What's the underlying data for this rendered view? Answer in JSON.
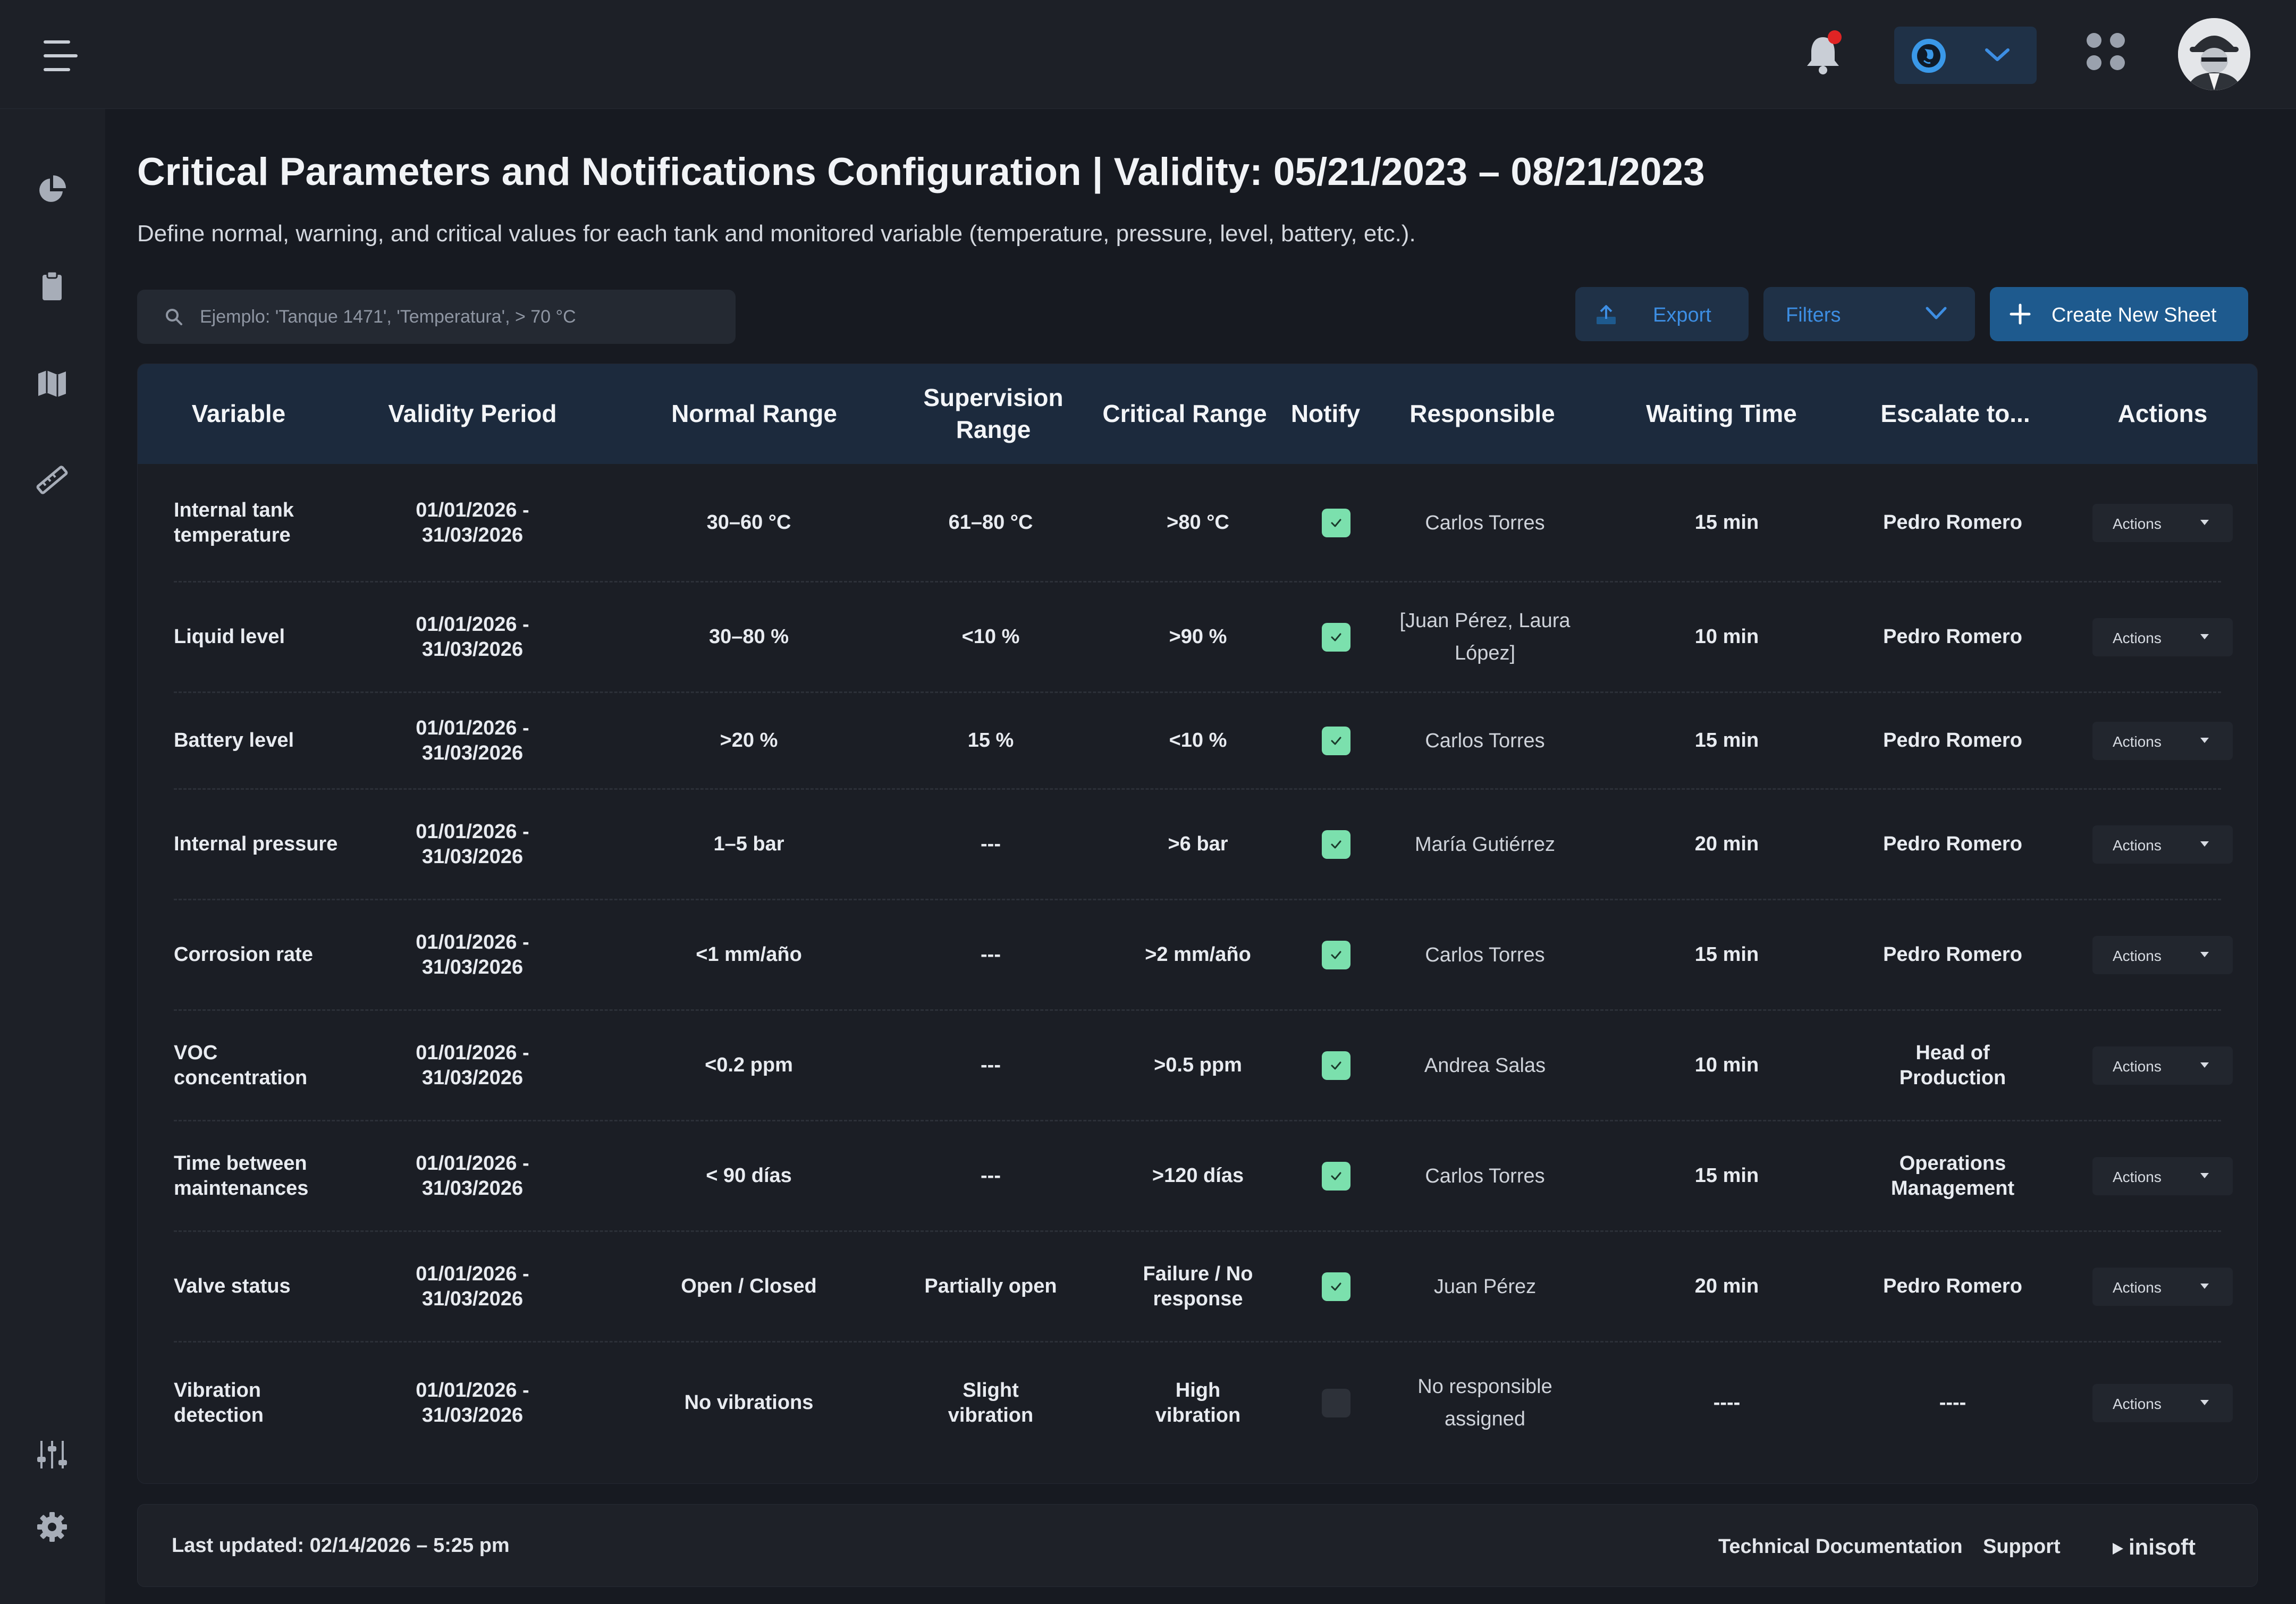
{
  "header": {
    "notification_dot_color": "#e02424",
    "accent": "#3d8ee3"
  },
  "page": {
    "title": "Critical Parameters and Notifications Configuration | Validity: 05/21/2023 – 08/21/2023",
    "subtitle": "Define normal, warning, and critical values for each tank and monitored variable (temperature, pressure, level, battery, etc.)."
  },
  "search": {
    "placeholder": "Ejemplo: 'Tanque 1471', 'Temperatura', > 70 °C"
  },
  "toolbar": {
    "export_label": "Export",
    "filters_label": "Filters",
    "create_label": "Create New Sheet"
  },
  "table": {
    "columns": [
      "Variable",
      "Validity Period",
      "Normal Range",
      "Supervision Range",
      "Critical Range",
      "Notify",
      "Responsible",
      "Waiting Time",
      "Escalate to...",
      "Actions"
    ],
    "rows": [
      {
        "variable": "Internal tank temperature",
        "validity": "01/01/2026 - 31/03/2026",
        "normal": "30–60 °C",
        "supervision": "61–80 °C",
        "critical": ">80 °C",
        "notify": true,
        "responsible": "Carlos Torres",
        "waiting": "15 min",
        "escalate": "Pedro Romero",
        "action": "Actions"
      },
      {
        "variable": "Liquid level",
        "validity": "01/01/2026 - 31/03/2026",
        "normal": "30–80 %",
        "supervision": "<10 %",
        "critical": ">90 %",
        "notify": true,
        "responsible": "[Juan Pérez, Laura López]",
        "waiting": "10 min",
        "escalate": "Pedro Romero",
        "action": "Actions"
      },
      {
        "variable": "Battery level",
        "validity": "01/01/2026 - 31/03/2026",
        "normal": ">20 %",
        "supervision": "15 %",
        "critical": "<10 %",
        "notify": true,
        "responsible": "Carlos Torres",
        "waiting": "15 min",
        "escalate": "Pedro Romero",
        "action": "Actions"
      },
      {
        "variable": "Internal pressure",
        "validity": "01/01/2026 - 31/03/2026",
        "normal": "1–5 bar",
        "supervision": "---",
        "critical": ">6 bar",
        "notify": true,
        "responsible": "María Gutiérrez",
        "waiting": "20 min",
        "escalate": "Pedro Romero",
        "action": "Actions"
      },
      {
        "variable": "Corrosion rate",
        "validity": "01/01/2026 - 31/03/2026",
        "normal": "<1 mm/año",
        "supervision": "---",
        "critical": ">2 mm/año",
        "notify": true,
        "responsible": "Carlos Torres",
        "waiting": "15 min",
        "escalate": "Pedro Romero",
        "action": "Actions"
      },
      {
        "variable": "VOC concentration",
        "validity": "01/01/2026 - 31/03/2026",
        "normal": "<0.2 ppm",
        "supervision": "---",
        "critical": ">0.5 ppm",
        "notify": true,
        "responsible": "Andrea Salas",
        "waiting": "10 min",
        "escalate": "Head of Production",
        "action": "Actions"
      },
      {
        "variable": "Time between maintenances",
        "validity": "01/01/2026 - 31/03/2026",
        "normal": "< 90 días",
        "supervision": "---",
        "critical": ">120 días",
        "notify": true,
        "responsible": "Carlos Torres",
        "waiting": "15 min",
        "escalate": "Operations Management",
        "action": "Actions"
      },
      {
        "variable": "Valve status",
        "validity": "01/01/2026 - 31/03/2026",
        "normal": "Open / Closed",
        "supervision": "Partially open",
        "critical": "Failure / No response",
        "notify": true,
        "responsible": "Juan Pérez",
        "waiting": "20 min",
        "escalate": "Pedro Romero",
        "action": "Actions"
      },
      {
        "variable": "Vibration detection",
        "validity": "01/01/2026 - 31/03/2026",
        "normal": "No vibrations",
        "supervision": "Slight vibration",
        "critical": "High vibration",
        "notify": false,
        "responsible": "No responsible assigned",
        "waiting": "----",
        "escalate": "----",
        "action": "Actions"
      }
    ]
  },
  "footer": {
    "last_updated": "Last updated: 02/14/2026 – 5:25 pm",
    "doc_link": "Technical Documentation",
    "support_link": "Support",
    "brand": "inisoft"
  }
}
